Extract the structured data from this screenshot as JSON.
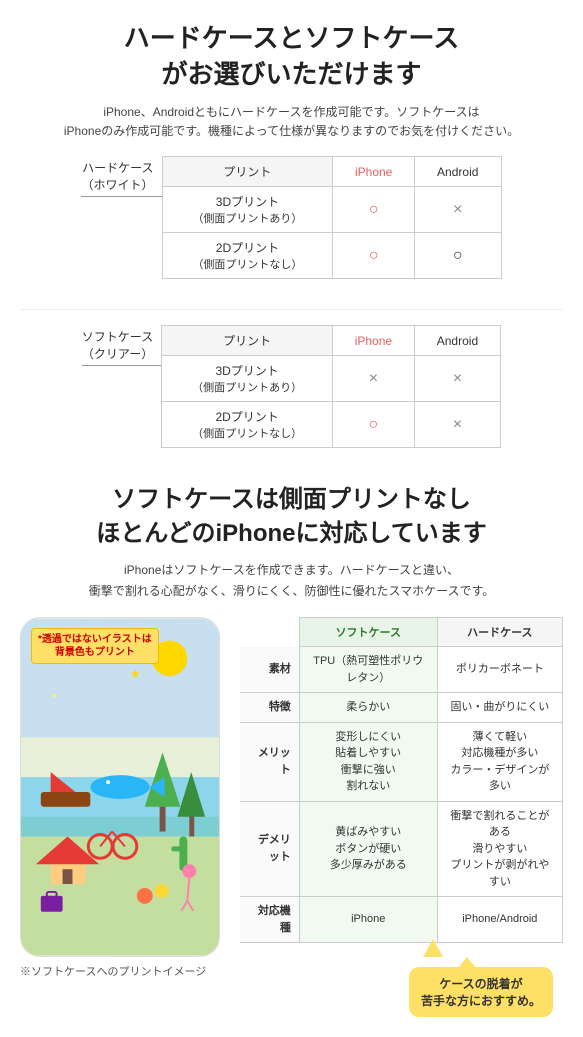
{
  "section1": {
    "title": "ハードケースとソフトケース\nがお選びいただけます",
    "description": "iPhone、Androidともにハードケースを作成可能です。ソフトケースは\niPhoneのみ作成可能です。機種によって仕様が異なりますのでお気を付けください。",
    "hard_case": {
      "label": "ハードケース\n（ホワイト）",
      "table": {
        "headers": [
          "プリント",
          "iPhone",
          "Android"
        ],
        "rows": [
          {
            "label": "3Dプリント\n（側面プリントあり）",
            "iphone": "○",
            "android": "×"
          },
          {
            "label": "2Dプリント\n（側面プリントなし）",
            "iphone": "○",
            "android": "○"
          }
        ]
      }
    },
    "soft_case": {
      "label": "ソフトケース\n（クリアー）",
      "table": {
        "headers": [
          "プリント",
          "iPhone",
          "Android"
        ],
        "rows": [
          {
            "label": "3Dプリント\n（側面プリントあり）",
            "iphone": "×",
            "android": "×"
          },
          {
            "label": "2Dプリント\n（側面プリントなし）",
            "iphone": "○",
            "android": "×"
          }
        ]
      }
    }
  },
  "section2": {
    "title": "ソフトケースは側面プリントなし\nほとんどのiPhoneに対応しています",
    "description": "iPhoneはソフトケースを作成できます。ハードケースと違い、\n衝撃で割れる心配がなく、滑りにくく、防御性に優れたスマホケースです。",
    "sticker_note": "*透過ではないイラストは\n背景色もプリント",
    "phone_note": "※ソフトケースへのプリントイメージ",
    "compare_table": {
      "headers": [
        "",
        "ソフトケース",
        "ハードケース"
      ],
      "rows": [
        {
          "label": "素材",
          "soft": "TPU（熱可塑性ポリウレタン）",
          "hard": "ポリカーボネート"
        },
        {
          "label": "特徴",
          "soft": "柔らかい",
          "hard": "固い・曲がりにくい"
        },
        {
          "label": "メリット",
          "soft": "変形しにくい\n貼着しやすい\n衝撃に強い\n割れない",
          "hard": "薄くて軽い\n対応機種が多い\nカラー・デザインが多い"
        },
        {
          "label": "デメリット",
          "soft": "黄ばみやすい\nボタンが硬い\n多少厚みがある",
          "hard": "衝撃で割れることがある\n滑りやすい\nプリントが剥がれやすい"
        },
        {
          "label": "対応機種",
          "soft": "iPhone",
          "hard": "iPhone/Android"
        }
      ]
    },
    "balloon": "ケースの脱着が\n苦手な方におすすめ。"
  }
}
